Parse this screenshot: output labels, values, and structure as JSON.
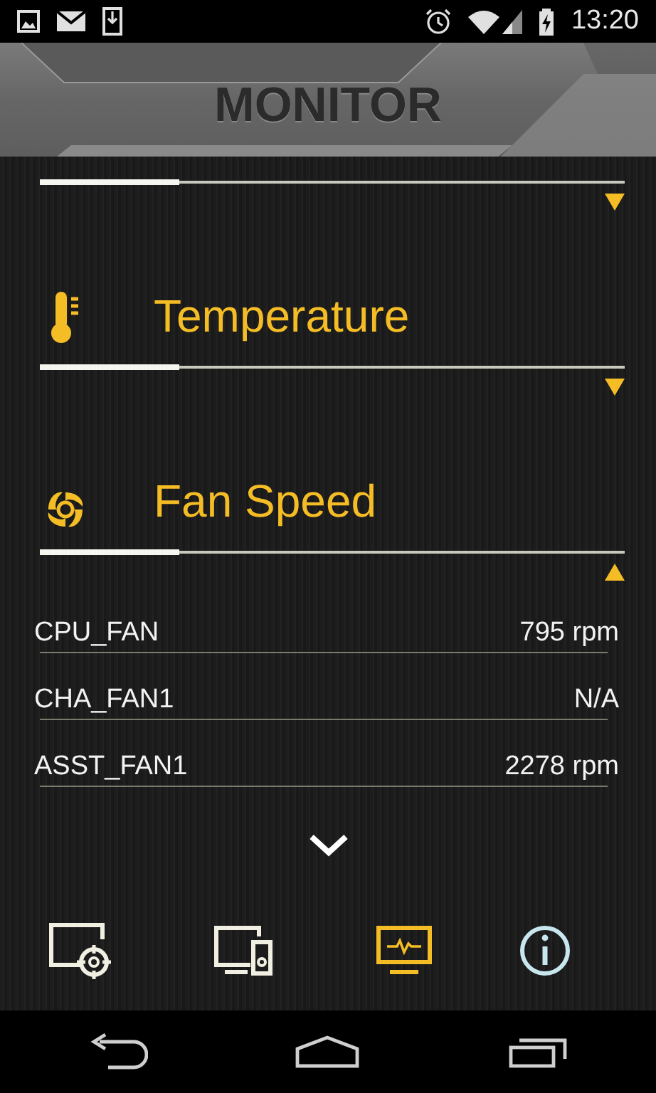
{
  "status_bar": {
    "time": "13:20"
  },
  "header": {
    "title": "MONITOR"
  },
  "sections": [
    {
      "expanded": false
    },
    {
      "kind": "temperature",
      "title": "Temperature",
      "expanded": false
    },
    {
      "kind": "fan",
      "title": "Fan Speed",
      "expanded": true,
      "rows": [
        {
          "name": "CPU_FAN",
          "value": "795 rpm"
        },
        {
          "name": "CHA_FAN1",
          "value": "N/A"
        },
        {
          "name": "ASST_FAN1",
          "value": "2278 rpm"
        }
      ]
    }
  ],
  "tabs": [
    {
      "kind": "target",
      "selected": false
    },
    {
      "kind": "devices",
      "selected": false
    },
    {
      "kind": "monitor",
      "selected": true
    }
  ]
}
